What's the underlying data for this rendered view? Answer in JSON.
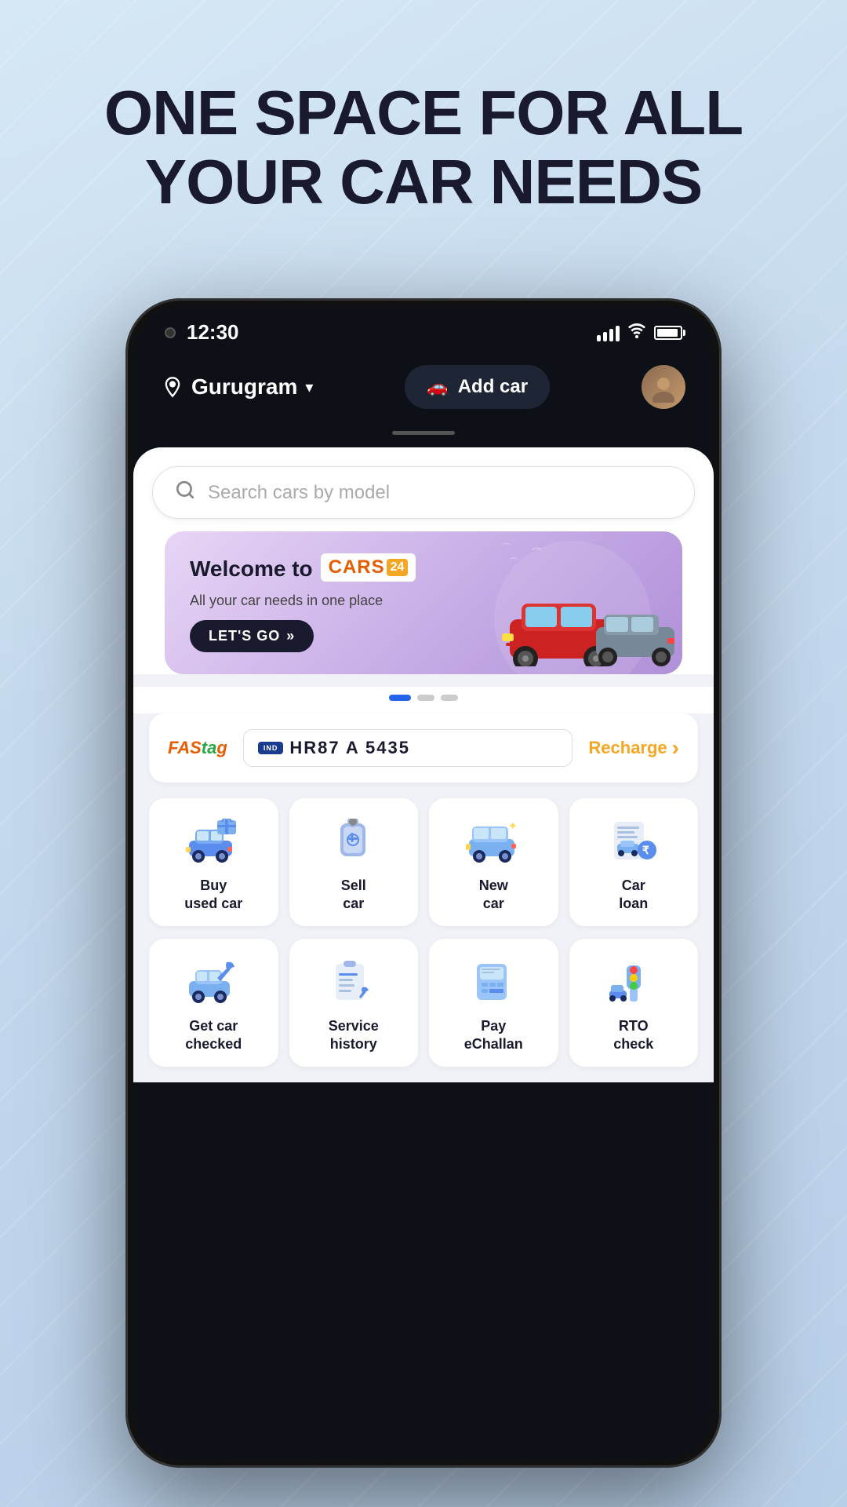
{
  "page": {
    "headline_line1": "ONE SPACE FOR ALL",
    "headline_line2": "YOUR CAR NEEDS"
  },
  "status_bar": {
    "time": "12:30",
    "signal": "signal-icon",
    "wifi": "wifi-icon",
    "battery": "battery-icon"
  },
  "nav": {
    "location": "Gurugram",
    "location_icon": "location-pin-icon",
    "chevron": "▾",
    "add_car_label": "Add car",
    "add_car_icon": "car-add-icon",
    "avatar_icon": "user-avatar-icon"
  },
  "search": {
    "placeholder": "Search cars by model",
    "icon": "search-icon"
  },
  "banner": {
    "welcome_text": "Welcome to",
    "brand_name": "CARS",
    "brand_badge": "24",
    "subtitle": "All your car needs in one place",
    "cta_label": "LET'S GO",
    "cta_arrows": "»"
  },
  "banner_dots": [
    {
      "active": true
    },
    {
      "active": false
    },
    {
      "active": false
    }
  ],
  "fastag": {
    "logo_text": "FASTag",
    "plate_country": "IND",
    "plate_number": "HR87 A 5435",
    "recharge_label": "Recharge",
    "recharge_arrow": "›"
  },
  "services_row1": [
    {
      "label": "Buy\nused car",
      "icon": "buy-used-car-icon"
    },
    {
      "label": "Sell\ncar",
      "icon": "sell-car-icon"
    },
    {
      "label": "New\ncar",
      "icon": "new-car-icon"
    },
    {
      "label": "Car\nloan",
      "icon": "car-loan-icon"
    }
  ],
  "services_row2": [
    {
      "label": "Get car\nchecked",
      "icon": "get-car-checked-icon"
    },
    {
      "label": "Service\nhistory",
      "icon": "service-history-icon"
    },
    {
      "label": "Pay\neChallan",
      "icon": "pay-echallan-icon"
    },
    {
      "label": "RTO\ncheck",
      "icon": "rto-check-icon"
    }
  ]
}
